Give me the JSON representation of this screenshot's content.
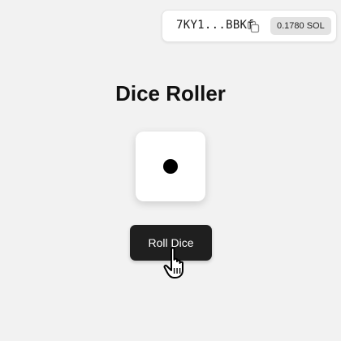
{
  "wallet": {
    "address": "7KY1...BBKf",
    "balance": "0.1780 SOL",
    "copy_icon": "copy-icon"
  },
  "game": {
    "title": "Dice Roller",
    "die_value": 1,
    "roll_button_label": "Roll Dice"
  },
  "cursor": {
    "icon": "hand-pointer-icon"
  },
  "colors": {
    "background": "#f2f2f2",
    "button": "#1f1f1f",
    "button_text": "#ffffff",
    "badge": "#e3e3e3",
    "pip": "#000000"
  }
}
